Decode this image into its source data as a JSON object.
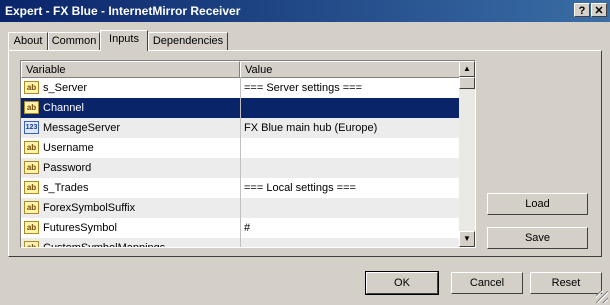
{
  "window": {
    "title": "Expert - FX Blue - InternetMirror Receiver",
    "help_btn": "?",
    "close_btn": "✕"
  },
  "tabs": [
    {
      "label": "About"
    },
    {
      "label": "Common"
    },
    {
      "label": "Inputs",
      "active": true
    },
    {
      "label": "Dependencies"
    }
  ],
  "grid": {
    "col_variable": "Variable",
    "col_value": "Value",
    "rows": [
      {
        "icon": "ab",
        "icon_text": "ab",
        "name": "s_Server",
        "value": "=== Server settings ==="
      },
      {
        "icon": "ab",
        "icon_text": "ab",
        "name": "Channel",
        "value": "",
        "selected": true
      },
      {
        "icon": "num",
        "icon_text": "123",
        "name": "MessageServer",
        "value": "FX Blue main hub (Europe)"
      },
      {
        "icon": "ab",
        "icon_text": "ab",
        "name": "Username",
        "value": ""
      },
      {
        "icon": "ab",
        "icon_text": "ab",
        "name": "Password",
        "value": ""
      },
      {
        "icon": "ab",
        "icon_text": "ab",
        "name": "s_Trades",
        "value": "=== Local settings ==="
      },
      {
        "icon": "ab",
        "icon_text": "ab",
        "name": "ForexSymbolSuffix",
        "value": ""
      },
      {
        "icon": "ab",
        "icon_text": "ab",
        "name": "FuturesSymbol",
        "value": "#"
      },
      {
        "icon": "ab",
        "icon_text": "ab",
        "name": "CustomSymbolMappings",
        "value": ""
      }
    ]
  },
  "side_buttons": {
    "load": "Load",
    "save": "Save"
  },
  "footer_buttons": {
    "ok": "OK",
    "cancel": "Cancel",
    "reset": "Reset"
  },
  "colors": {
    "titlebar": "#0a246a",
    "selection": "#0a246a",
    "face": "#d4d0c8"
  }
}
